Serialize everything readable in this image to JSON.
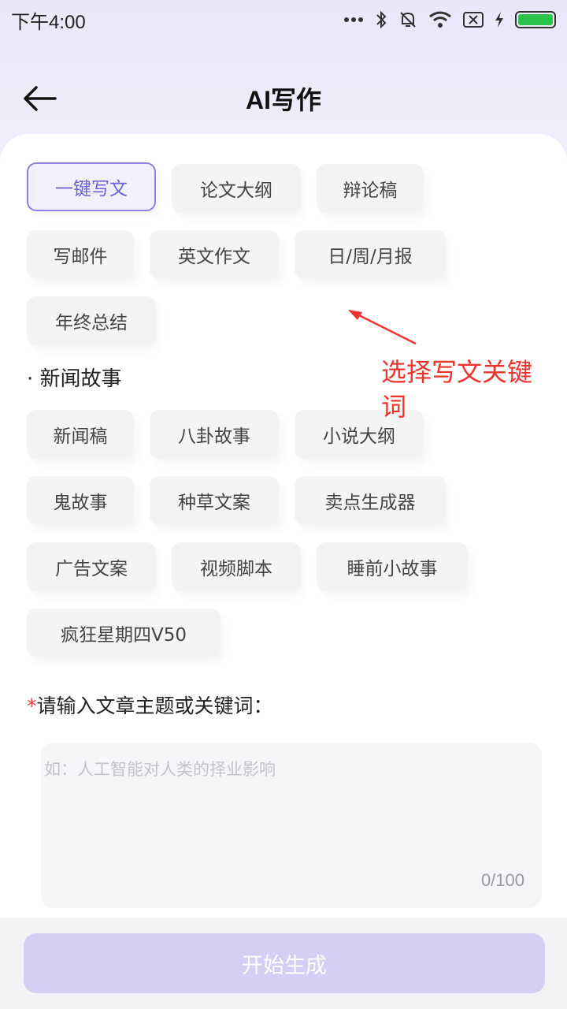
{
  "status_bar": {
    "time": "下午4:00",
    "icons": [
      "more-icon",
      "bluetooth-icon",
      "mute-icon",
      "wifi-icon",
      "sim-off-icon",
      "charging-icon",
      "battery-icon"
    ],
    "battery_color": "#2bc24a"
  },
  "header": {
    "title": "AI写作",
    "back_icon": "arrow-left-icon"
  },
  "categories_top": [
    {
      "label": "一键写文",
      "selected": true
    },
    {
      "label": "论文大纲",
      "selected": false
    },
    {
      "label": "辩论稿",
      "selected": false
    },
    {
      "label": "写邮件",
      "selected": false
    },
    {
      "label": "英文作文",
      "selected": false
    },
    {
      "label": "日/周/月报",
      "selected": false
    },
    {
      "label": "年终总结",
      "selected": false
    }
  ],
  "news_section": {
    "title": "· 新闻故事",
    "items": [
      {
        "label": "新闻稿"
      },
      {
        "label": "八卦故事"
      },
      {
        "label": "小说大纲"
      },
      {
        "label": "鬼故事"
      },
      {
        "label": "种草文案"
      },
      {
        "label": "卖点生成器"
      },
      {
        "label": "广告文案"
      },
      {
        "label": "视频脚本"
      },
      {
        "label": "睡前小故事"
      },
      {
        "label": "疯狂星期四V50"
      }
    ]
  },
  "annotation": {
    "text": "选择写文关键词",
    "color": "#f0322c"
  },
  "input": {
    "required_mark": "*",
    "label": "请输入文章主题或关键词：",
    "value": "",
    "placeholder": "如：人工智能对人类的择业影响",
    "counter": "0/100"
  },
  "generate_button": {
    "label": "开始生成",
    "color": "#d5cff6"
  },
  "colors": {
    "accent": "#6d63d4",
    "selected_border": "#8a83d8"
  }
}
